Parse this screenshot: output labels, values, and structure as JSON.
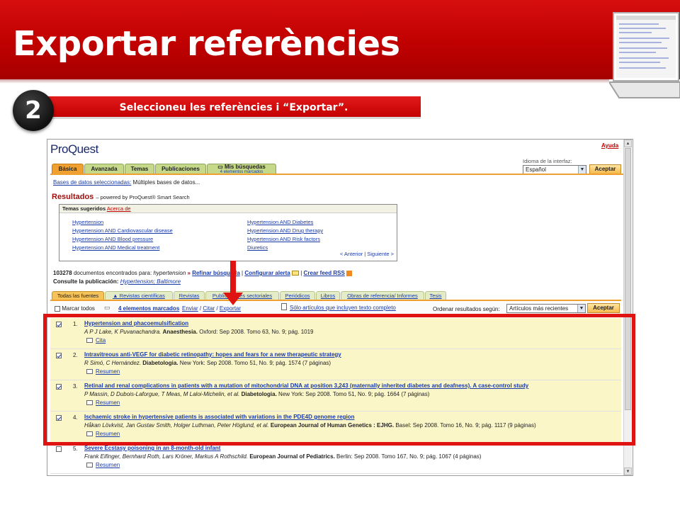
{
  "slide": {
    "title": "Exportar referències",
    "step_number": "2",
    "step_text": "Seleccioneu les referències i “Exportar”."
  },
  "proquest": {
    "logo": "ProQuest",
    "help": "Ayuda",
    "tabs": [
      {
        "label": "Básica"
      },
      {
        "label": "Avanzada"
      },
      {
        "label": "Temas"
      },
      {
        "label": "Publicaciones"
      },
      {
        "label": "Mis búsquedas",
        "sub": "4 elementos marcados"
      }
    ],
    "interface_language_label": "Idioma de la interfaz:",
    "interface_language_value": "Español",
    "accept_label": "Aceptar",
    "databases_link": "Bases de datos seleccionadas:",
    "databases_value": "Múltiples bases de datos...",
    "results_title": "Resultados",
    "results_powered": "– powered by ProQuest® Smart Search",
    "topics": {
      "header": "Temas sugeridos",
      "header_link": "Acerca de",
      "left": [
        "Hypertension",
        "Hypertension AND Cardiovascular disease",
        "Hypertension AND Blood pressure",
        "Hypertension AND Medical treatment"
      ],
      "right": [
        "Hypertension AND Diabetes",
        "Hypertension AND Drug therapy",
        "Hypertension AND Risk factors",
        "Diuretics"
      ],
      "prev": "< Anterior",
      "next": "Siguiente >"
    },
    "count": {
      "number": "103278",
      "text": "documentos encontrados para:",
      "query": "hypertension",
      "refine": "Refinar búsqueda",
      "alert": "Configurar alerta",
      "rss": "Crear feed RSS"
    },
    "publication": {
      "label": "Consulte la publicación:",
      "value": "Hypertension; Baltimore"
    },
    "source_tabs": [
      "Todas las fuentes",
      "Revistas científicas",
      "Revistas",
      "Publicaciones sectoriales",
      "Periódicos",
      "Libros",
      "Obras de referencia/ Informes",
      "Tesis"
    ],
    "toolbar": {
      "mark_all": "Marcar todos",
      "marked": "4 elementos marcados",
      "send": "Enviar",
      "cite": "Citar",
      "export": "Exportar",
      "fulltext_only": "Sólo artículos que incluyen texto completo",
      "sort_label": "Ordenar resultados según:",
      "sort_value": "Artículos más recientes",
      "accept": "Aceptar"
    },
    "results": [
      {
        "num": "1.",
        "checked": true,
        "title": "Hypertension and phacoemulsification",
        "authors": "A P J Lake, K Puvanachandra.",
        "journal": "Anaesthesia.",
        "details": "Oxford: Sep 2008. Tomo 63, No. 9; pág. 1019",
        "action": "Cita"
      },
      {
        "num": "2.",
        "checked": true,
        "title": "Intravitreous anti-VEGF for diabetic retinopathy: hopes and fears for a new therapeutic strategy",
        "authors": "R Simó, C Hernández.",
        "journal": "Diabetologia.",
        "details": "New York: Sep 2008. Tomo 51, No. 9; pág. 1574 (7 páginas)",
        "action": "Resumen"
      },
      {
        "num": "3.",
        "checked": true,
        "title": "Retinal and renal complications in patients with a mutation of mitochondrial DNA at position 3,243 (maternally inherited diabetes and deafness). A case-control study",
        "authors": "P Massin, D Dubois-Laforgue, T Meas, M Laloi-Michelin, et al.",
        "journal": "Diabetologia.",
        "details": "New York: Sep 2008. Tomo 51, No. 9; pág. 1664 (7 páginas)",
        "action": "Resumen"
      },
      {
        "num": "4.",
        "checked": true,
        "title": "Ischaemic stroke in hypertensive patients is associated with variations in the PDE4D genome region",
        "authors": "Håkan Lövkvist, Jan Gustav Smith, Holger Luthman, Peter Höglund, et al.",
        "journal": "European Journal of Human Genetics : EJHG.",
        "details": "Basel: Sep 2008. Tomo 16, No. 9; pág. 1117 (9 páginas)",
        "action": "Resumen"
      },
      {
        "num": "5.",
        "checked": false,
        "title": "Severe Ecstasy poisoning in an 8-month-old infant",
        "authors": "Frank Eifinger, Bernhard Roth, Lars Kröner, Markus A Rothschild.",
        "journal": "European Journal of Pediatrics.",
        "details": "Berlin: Sep 2008. Tomo 167, No. 9; pág. 1067 (4 páginas)",
        "action": "Resumen"
      }
    ]
  },
  "colors": {
    "banner_red": "#c00000",
    "highlight_red": "#e01313",
    "link_blue": "#1a3aa7",
    "selected_row": "#fbf6c8",
    "tab_orange": "#f0a030",
    "tab_green": "#c6d88a"
  }
}
